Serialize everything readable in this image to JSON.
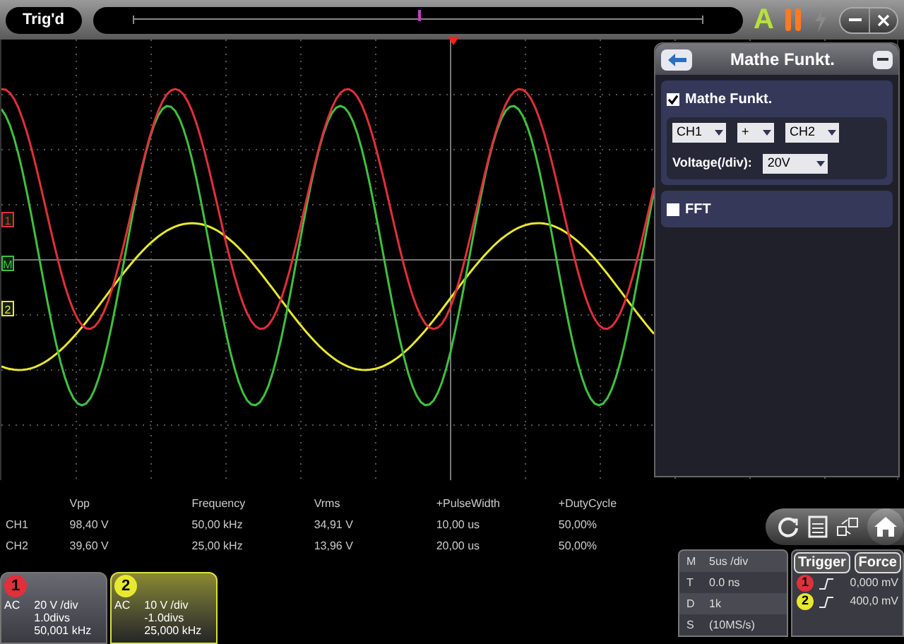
{
  "top_bar": {
    "status": "Trig'd",
    "auto_label": "A",
    "run_paused": true,
    "lightning_enabled": false
  },
  "channel_markers": [
    {
      "label": "1",
      "color": "#e0303a"
    },
    {
      "label": "M",
      "color": "#40c040"
    },
    {
      "label": "2",
      "color": "#e8e830"
    }
  ],
  "math_panel": {
    "title": "Mathe Funkt.",
    "math_enabled": {
      "label": "Mathe Funkt.",
      "checked": true
    },
    "source_1": "CH1",
    "operator": "+",
    "source_2": "CH2",
    "voltage_label": "Voltage(/div):",
    "voltage": "20V",
    "fft": {
      "label": "FFT",
      "checked": false
    }
  },
  "measurements": {
    "columns": [
      "Vpp",
      "Frequency",
      "Vrms",
      "+PulseWidth",
      "+DutyCycle"
    ],
    "rows": [
      {
        "channel": "CH1",
        "values": [
          "98,40 V",
          "50,00 kHz",
          "34,91 V",
          "10,00 us",
          "50,00%"
        ]
      },
      {
        "channel": "CH2",
        "values": [
          "39,60 V",
          "25,00 kHz",
          "13,96 V",
          "20,00 us",
          "50,00%"
        ]
      }
    ]
  },
  "channels": [
    {
      "number": "1",
      "color": "#e0303a",
      "selected": false,
      "coupling": "AC",
      "scale": "20 V /div",
      "offset": "1.0divs",
      "frequency": "50,001 kHz"
    },
    {
      "number": "2",
      "color": "#e8e830",
      "selected": true,
      "coupling": "AC",
      "scale": "10 V /div",
      "offset": "-1.0divs",
      "frequency": "25,000 kHz"
    }
  ],
  "timebase": [
    {
      "key": "M",
      "value": "5us /div"
    },
    {
      "key": "T",
      "value": "0.0 ns"
    },
    {
      "key": "D",
      "value": "1k"
    },
    {
      "key": "S",
      "value": "(10MS/s)"
    }
  ],
  "trigger": {
    "trigger_button": "Trigger",
    "force_button": "Force",
    "levels": [
      {
        "channel": "1",
        "color": "#e0303a",
        "value": "0,000 mV"
      },
      {
        "channel": "2",
        "color": "#e8e830",
        "value": "400,0 mV"
      }
    ]
  }
}
